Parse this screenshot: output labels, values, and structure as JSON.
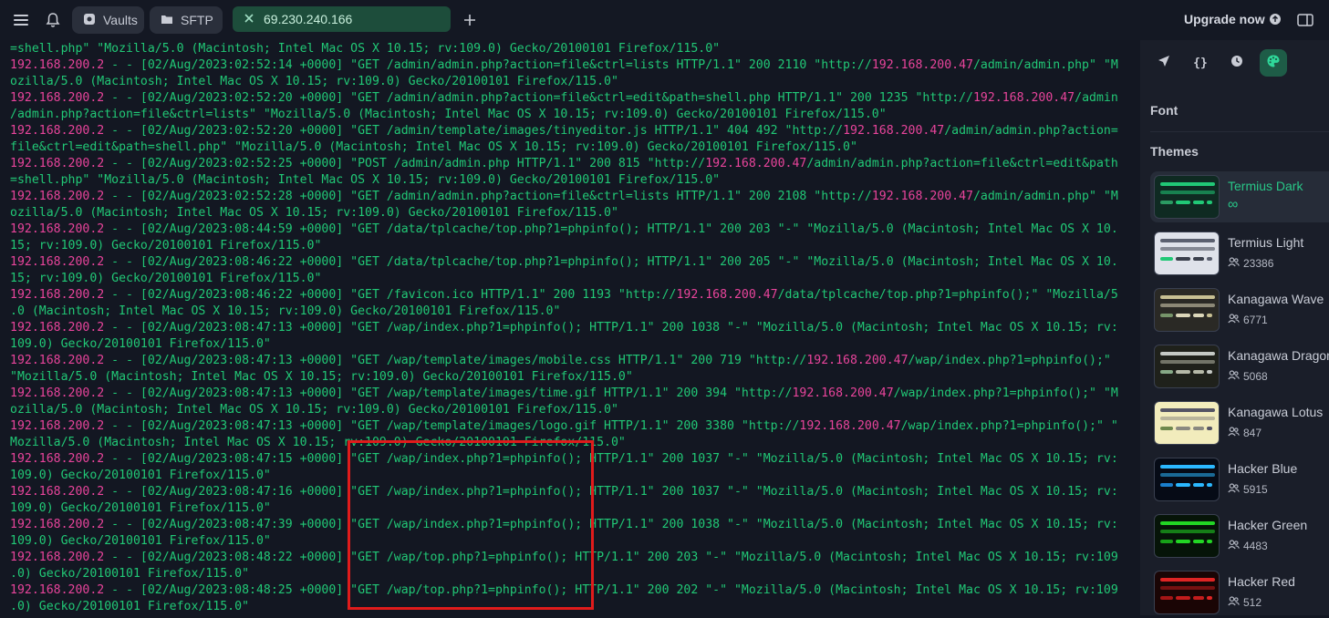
{
  "topbar": {
    "tabs": [
      {
        "label": "Vaults"
      },
      {
        "label": "SFTP"
      }
    ],
    "host_tab": {
      "label": "69.230.240.166"
    },
    "upgrade_label": "Upgrade now"
  },
  "terminal": {
    "lines": [
      [
        {
          "t": "=shell.php\" \"Mozilla/5.0 (Macintosh; Intel Mac OS X 10.15; rv:109.0) Gecko/20100101 Firefox/115.0\""
        }
      ],
      [
        {
          "t": "192.168.200.2",
          "ip": true
        },
        {
          "t": " - - [02/Aug/2023:02:52:14 +0000] \"GET /admin/admin.php?action=file&ctrl=lists HTTP/1.1\" 200 2110 \"http://"
        },
        {
          "t": "192.168.200.47",
          "ip": true
        },
        {
          "t": "/admin/admin.php\" \"M"
        }
      ],
      [
        {
          "t": "ozilla/5.0 (Macintosh; Intel Mac OS X 10.15; rv:109.0) Gecko/20100101 Firefox/115.0\""
        }
      ],
      [
        {
          "t": "192.168.200.2",
          "ip": true
        },
        {
          "t": " - - [02/Aug/2023:02:52:20 +0000] \"GET /admin/admin.php?action=file&ctrl=edit&path=shell.php HTTP/1.1\" 200 1235 \"http://"
        },
        {
          "t": "192.168.200.47",
          "ip": true
        },
        {
          "t": "/admin"
        }
      ],
      [
        {
          "t": "/admin.php?action=file&ctrl=lists\" \"Mozilla/5.0 (Macintosh; Intel Mac OS X 10.15; rv:109.0) Gecko/20100101 Firefox/115.0\""
        }
      ],
      [
        {
          "t": "192.168.200.2",
          "ip": true
        },
        {
          "t": " - - [02/Aug/2023:02:52:20 +0000] \"GET /admin/template/images/tinyeditor.js HTTP/1.1\" 404 492 \"http://"
        },
        {
          "t": "192.168.200.47",
          "ip": true
        },
        {
          "t": "/admin/admin.php?action="
        }
      ],
      [
        {
          "t": "file&ctrl=edit&path=shell.php\" \"Mozilla/5.0 (Macintosh; Intel Mac OS X 10.15; rv:109.0) Gecko/20100101 Firefox/115.0\""
        }
      ],
      [
        {
          "t": "192.168.200.2",
          "ip": true
        },
        {
          "t": " - - [02/Aug/2023:02:52:25 +0000] \"POST /admin/admin.php HTTP/1.1\" 200 815 \"http://"
        },
        {
          "t": "192.168.200.47",
          "ip": true
        },
        {
          "t": "/admin/admin.php?action=file&ctrl=edit&path"
        }
      ],
      [
        {
          "t": "=shell.php\" \"Mozilla/5.0 (Macintosh; Intel Mac OS X 10.15; rv:109.0) Gecko/20100101 Firefox/115.0\""
        }
      ],
      [
        {
          "t": "192.168.200.2",
          "ip": true
        },
        {
          "t": " - - [02/Aug/2023:02:52:28 +0000] \"GET /admin/admin.php?action=file&ctrl=lists HTTP/1.1\" 200 2108 \"http://"
        },
        {
          "t": "192.168.200.47",
          "ip": true
        },
        {
          "t": "/admin/admin.php\" \"M"
        }
      ],
      [
        {
          "t": "ozilla/5.0 (Macintosh; Intel Mac OS X 10.15; rv:109.0) Gecko/20100101 Firefox/115.0\""
        }
      ],
      [
        {
          "t": "192.168.200.2",
          "ip": true
        },
        {
          "t": " - - [02/Aug/2023:08:44:59 +0000] \"GET /data/tplcache/top.php?1=phpinfo(); HTTP/1.1\" 200 203 \"-\" \"Mozilla/5.0 (Macintosh; Intel Mac OS X 10."
        }
      ],
      [
        {
          "t": "15; rv:109.0) Gecko/20100101 Firefox/115.0\""
        }
      ],
      [
        {
          "t": "192.168.200.2",
          "ip": true
        },
        {
          "t": " - - [02/Aug/2023:08:46:22 +0000] \"GET /data/tplcache/top.php?1=phpinfo(); HTTP/1.1\" 200 205 \"-\" \"Mozilla/5.0 (Macintosh; Intel Mac OS X 10."
        }
      ],
      [
        {
          "t": "15; rv:109.0) Gecko/20100101 Firefox/115.0\""
        }
      ],
      [
        {
          "t": "192.168.200.2",
          "ip": true
        },
        {
          "t": " - - [02/Aug/2023:08:46:22 +0000] \"GET /favicon.ico HTTP/1.1\" 200 1193 \"http://"
        },
        {
          "t": "192.168.200.47",
          "ip": true
        },
        {
          "t": "/data/tplcache/top.php?1=phpinfo();\" \"Mozilla/5"
        }
      ],
      [
        {
          "t": ".0 (Macintosh; Intel Mac OS X 10.15; rv:109.0) Gecko/20100101 Firefox/115.0\""
        }
      ],
      [
        {
          "t": "192.168.200.2",
          "ip": true
        },
        {
          "t": " - - [02/Aug/2023:08:47:13 +0000] \"GET /wap/index.php?1=phpinfo(); HTTP/1.1\" 200 1038 \"-\" \"Mozilla/5.0 (Macintosh; Intel Mac OS X 10.15; rv:"
        }
      ],
      [
        {
          "t": "109.0) Gecko/20100101 Firefox/115.0\""
        }
      ],
      [
        {
          "t": "192.168.200.2",
          "ip": true
        },
        {
          "t": " - - [02/Aug/2023:08:47:13 +0000] \"GET /wap/template/images/mobile.css HTTP/1.1\" 200 719 \"http://"
        },
        {
          "t": "192.168.200.47",
          "ip": true
        },
        {
          "t": "/wap/index.php?1=phpinfo();\""
        }
      ],
      [
        {
          "t": "\"Mozilla/5.0 (Macintosh; Intel Mac OS X 10.15; rv:109.0) Gecko/20100101 Firefox/115.0\""
        }
      ],
      [
        {
          "t": "192.168.200.2",
          "ip": true
        },
        {
          "t": " - - [02/Aug/2023:08:47:13 +0000] \"GET /wap/template/images/time.gif HTTP/1.1\" 200 394 \"http://"
        },
        {
          "t": "192.168.200.47",
          "ip": true
        },
        {
          "t": "/wap/index.php?1=phpinfo();\" \"M"
        }
      ],
      [
        {
          "t": "ozilla/5.0 (Macintosh; Intel Mac OS X 10.15; rv:109.0) Gecko/20100101 Firefox/115.0\""
        }
      ],
      [
        {
          "t": "192.168.200.2",
          "ip": true
        },
        {
          "t": " - - [02/Aug/2023:08:47:13 +0000] \"GET /wap/template/images/logo.gif HTTP/1.1\" 200 3380 \"http://"
        },
        {
          "t": "192.168.200.47",
          "ip": true
        },
        {
          "t": "/wap/index.php?1=phpinfo();\" \""
        }
      ],
      [
        {
          "t": "Mozilla/5.0 (Macintosh; Intel Mac OS X 10.15; rv:109.0) Gecko/20100101 Firefox/115.0\""
        }
      ],
      [
        {
          "t": "192.168.200.2",
          "ip": true
        },
        {
          "t": " - - [02/Aug/2023:08:47:15 +0000] \"GET /wap/index.php?1=phpinfo(); HTTP/1.1\" 200 1037 \"-\" \"Mozilla/5.0 (Macintosh; Intel Mac OS X 10.15; rv:"
        }
      ],
      [
        {
          "t": "109.0) Gecko/20100101 Firefox/115.0\""
        }
      ],
      [
        {
          "t": "192.168.200.2",
          "ip": true
        },
        {
          "t": " - - [02/Aug/2023:08:47:16 +0000] \"GET /wap/index.php?1=phpinfo(); HTTP/1.1\" 200 1037 \"-\" \"Mozilla/5.0 (Macintosh; Intel Mac OS X 10.15; rv:"
        }
      ],
      [
        {
          "t": "109.0) Gecko/20100101 Firefox/115.0\""
        }
      ],
      [
        {
          "t": "192.168.200.2",
          "ip": true
        },
        {
          "t": " - - [02/Aug/2023:08:47:39 +0000] \"GET /wap/index.php?1=phpinfo(); HTTP/1.1\" 200 1038 \"-\" \"Mozilla/5.0 (Macintosh; Intel Mac OS X 10.15; rv:"
        }
      ],
      [
        {
          "t": "109.0) Gecko/20100101 Firefox/115.0\""
        }
      ],
      [
        {
          "t": "192.168.200.2",
          "ip": true
        },
        {
          "t": " - - [02/Aug/2023:08:48:22 +0000] \"GET /wap/top.php?1=phpinfo(); HTTP/1.1\" 200 203 \"-\" \"Mozilla/5.0 (Macintosh; Intel Mac OS X 10.15; rv:109"
        }
      ],
      [
        {
          "t": ".0) Gecko/20100101 Firefox/115.0\""
        }
      ],
      [
        {
          "t": "192.168.200.2",
          "ip": true
        },
        {
          "t": " - - [02/Aug/2023:08:48:25 +0000] \"GET /wap/top.php?1=phpinfo(); HTTP/1.1\" 200 202 \"-\" \"Mozilla/5.0 (Macintosh; Intel Mac OS X 10.15; rv:109"
        }
      ],
      [
        {
          "t": ".0) Gecko/20100101 Firefox/115.0\""
        }
      ]
    ]
  },
  "side": {
    "font_label": "Font",
    "themes_label": "Themes",
    "themes": [
      {
        "name": "Termius Dark",
        "meta": "∞",
        "selected": true,
        "bg": "#0f2a22",
        "colors": [
          "#21c876",
          "#21c876",
          "#2b9a62"
        ]
      },
      {
        "name": "Termius Light",
        "meta": "23386",
        "bg": "#dfe2ea",
        "colors": [
          "#5b6070",
          "#3a3f4c",
          "#21c876"
        ]
      },
      {
        "name": "Kanagawa Wave",
        "meta": "6771",
        "bg": "#2a2925",
        "colors": [
          "#c8c093",
          "#dcd7ba",
          "#76946a"
        ]
      },
      {
        "name": "Kanagawa Dragon",
        "meta": "5068",
        "bg": "#1f211b",
        "colors": [
          "#c5c9c5",
          "#b6b9a8",
          "#87a987"
        ]
      },
      {
        "name": "Kanagawa Lotus",
        "meta": "847",
        "bg": "#f2ecbc",
        "colors": [
          "#545464",
          "#8a8980",
          "#6f894e"
        ]
      },
      {
        "name": "Hacker Blue",
        "meta": "5915",
        "bg": "#060b16",
        "colors": [
          "#2bb8ff",
          "#2bb8ff",
          "#1a7fcc"
        ]
      },
      {
        "name": "Hacker Green",
        "meta": "4483",
        "bg": "#061408",
        "colors": [
          "#22d624",
          "#22d624",
          "#17a118"
        ]
      },
      {
        "name": "Hacker Red",
        "meta": "512",
        "bg": "#1a0505",
        "colors": [
          "#e02424",
          "#c41c1c",
          "#a51515"
        ]
      }
    ]
  },
  "colors": {
    "terminal_text": "#21c876",
    "ip_highlight": "#e8449b",
    "annotation_box": "#e01b1b",
    "accent": "#28c687"
  }
}
